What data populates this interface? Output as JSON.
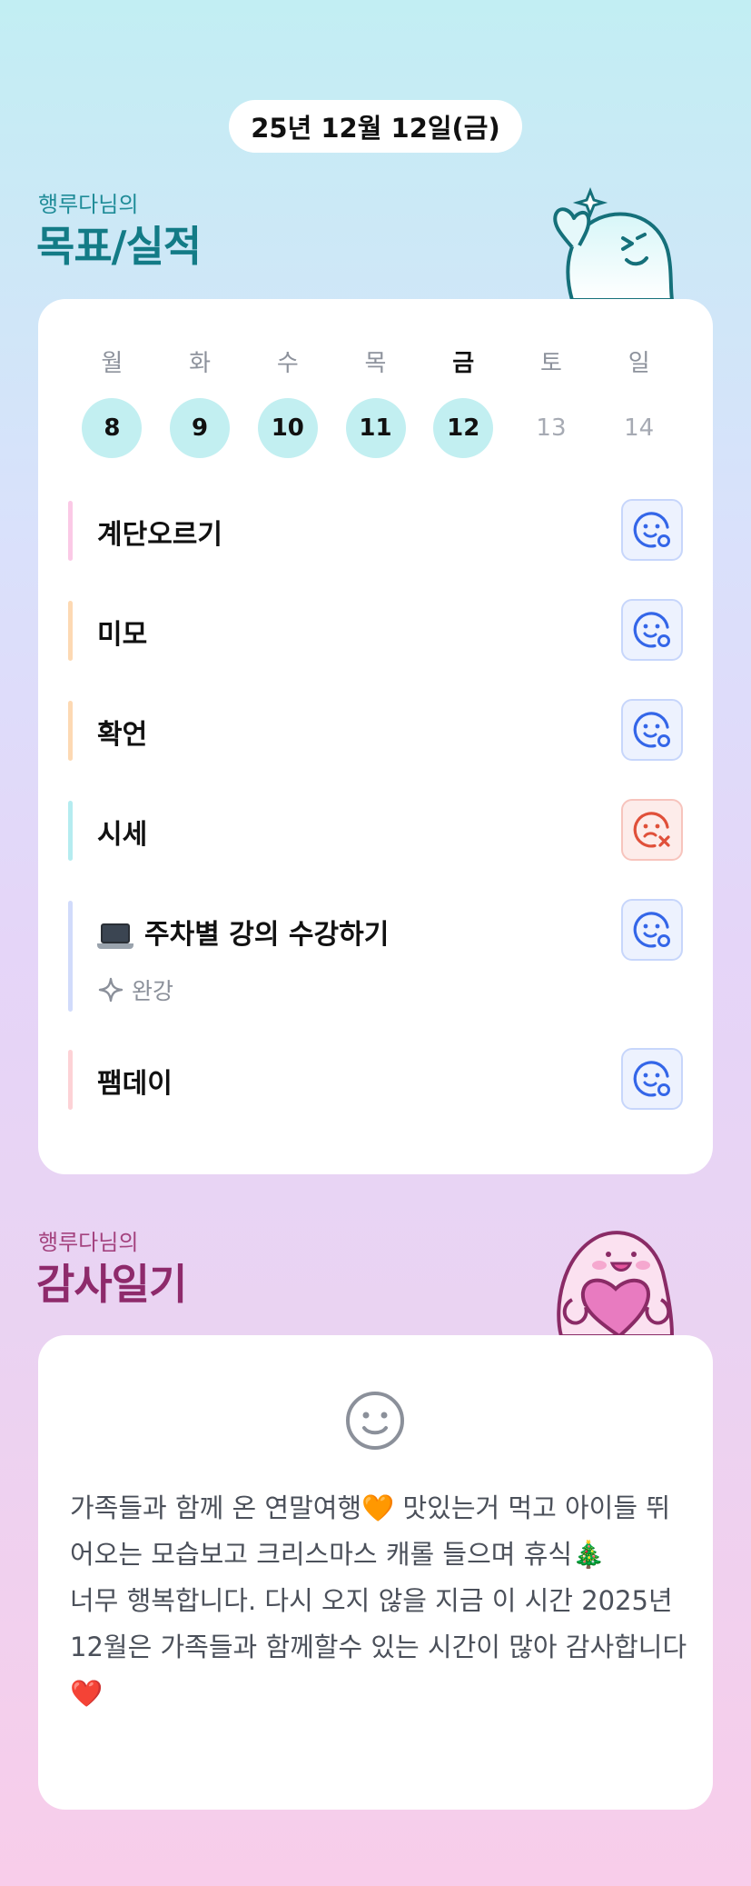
{
  "header": {
    "date": "25년 12월 12일(금)"
  },
  "goals_section": {
    "subtitle": "행루다님의",
    "title": "목표/실적",
    "week": {
      "weekdays": [
        "월",
        "화",
        "수",
        "목",
        "금",
        "토",
        "일"
      ],
      "days": [
        "8",
        "9",
        "10",
        "11",
        "12",
        "13",
        "14"
      ],
      "completed_days": [
        "8",
        "9",
        "10",
        "11",
        "12"
      ],
      "today": "금"
    },
    "goals": [
      {
        "label": "계단오르기",
        "color": "#fbc9e6",
        "status": "smile-o-icon"
      },
      {
        "label": "미모",
        "color": "#fdd9b3",
        "status": "smile-o-icon"
      },
      {
        "label": "확언",
        "color": "#fdd9b3",
        "status": "smile-o-icon"
      },
      {
        "label": "시세",
        "color": "#b5ecf0",
        "status": "sad-x-icon"
      },
      {
        "label": "주차별 강의 수강하기",
        "icon": "laptop-icon",
        "note": "완강",
        "note_icon": "sparkle-icon",
        "color": "#d1dbfb",
        "status": "smile-o-icon"
      },
      {
        "label": "팸데이",
        "color": "#fdd2d6",
        "status": "smile-o-icon"
      }
    ]
  },
  "gratitude_section": {
    "subtitle": "행루다님의",
    "title": "감사일기",
    "mood_icon": "smiley-face-icon",
    "entry": "가족들과 함께 온 연말여행🧡 맛있는거 먹고 아이들 뛰어오는 모습보고 크리스마스 캐롤 들으며 휴식🎄\n너무 행복합니다. 다시 오지 않을 지금 이 시간 2025년 12월은 가족들과 함께할수 있는 시간이 많아 감사합니다❤️"
  },
  "colors": {
    "ok_icon": "#3466e8",
    "bad_icon": "#e0503a",
    "goals_title": "#137b86",
    "gratitude_title": "#8e2a6b"
  }
}
